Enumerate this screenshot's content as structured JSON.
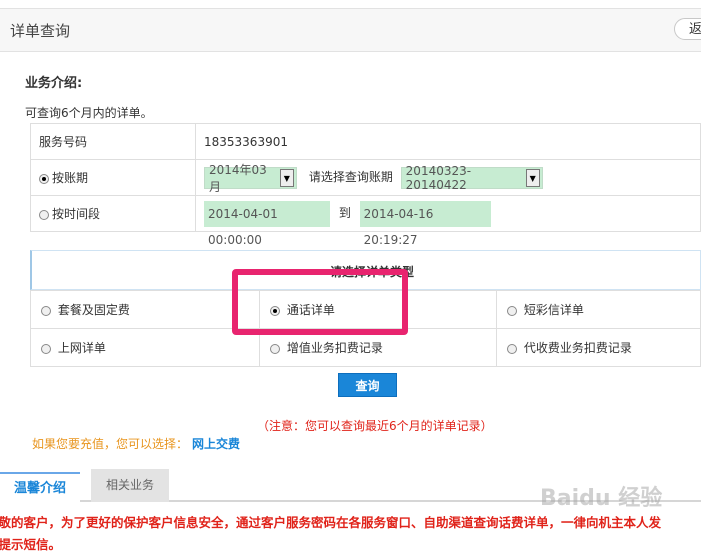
{
  "header": {
    "title": "详单查询",
    "back_label": "返"
  },
  "intro": {
    "title": "业务介绍:",
    "desc": "可查询6个月内的详单。"
  },
  "form": {
    "service_number_label": "服务号码",
    "service_number": "18353363901",
    "by_period_label": "按账期",
    "period_value": "2014年03月",
    "choose_period_label": "请选择查询账期",
    "period_range": "20140323-20140422",
    "by_time_label": "按时间段",
    "time_start": "2014-04-01 00:00:00",
    "to_label": "到",
    "time_end": "2014-04-16 20:19:27"
  },
  "types": {
    "header": "请选择详单类型",
    "options": [
      {
        "label": "套餐及固定费",
        "checked": false
      },
      {
        "label": "通话详单",
        "checked": true
      },
      {
        "label": "短彩信详单",
        "checked": false
      },
      {
        "label": "上网详单",
        "checked": false
      },
      {
        "label": "增值业务扣费记录",
        "checked": false
      },
      {
        "label": "代收费业务扣费记录",
        "checked": false
      }
    ]
  },
  "actions": {
    "query_label": "查询"
  },
  "note": "（注意：您可以查询最近6个月的详单记录）",
  "recharge": {
    "text": "如果您要充值，您可以选择：",
    "link": "网上交费"
  },
  "tabs": {
    "tab1": "温馨介绍",
    "tab2": "相关业务"
  },
  "warning": {
    "line1": "尊敬的客户，为了更好的保护客户信息安全，通过客户服务密码在各服务窗口、自助渠道查询话费详单，一律向机主本人发",
    "line2": "送提示短信。"
  },
  "watermark": "Baidu 经验",
  "colors": {
    "accent": "#1a86d8",
    "highlight": "#e8246f",
    "warning": "#e0231a",
    "field_bg": "#c7ecd2"
  }
}
